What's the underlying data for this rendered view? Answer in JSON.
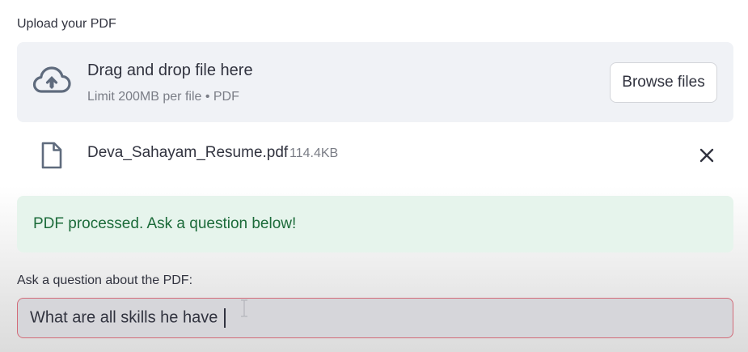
{
  "uploader": {
    "label": "Upload your PDF",
    "dropzone_title": "Drag and drop file here",
    "dropzone_subtitle": "Limit 200MB per file • PDF",
    "browse_button": "Browse files",
    "upload_icon": "cloud-upload-icon"
  },
  "uploaded_file": {
    "name": "Deva_Sahayam_Resume.pdf",
    "size": "114.4KB",
    "file_icon": "file-icon",
    "remove_icon": "close-icon"
  },
  "status": {
    "message": "PDF processed. Ask a question below!",
    "color": "#1c6b3a",
    "background": "#e6f4ec"
  },
  "question": {
    "label": "Ask a question about the PDF:",
    "value": "What are all skills he have "
  },
  "colors": {
    "dropzone_bg": "#f0f2f6",
    "input_border_focus": "#d26b78",
    "text": "#31333f",
    "muted_text": "#7a7d86"
  }
}
